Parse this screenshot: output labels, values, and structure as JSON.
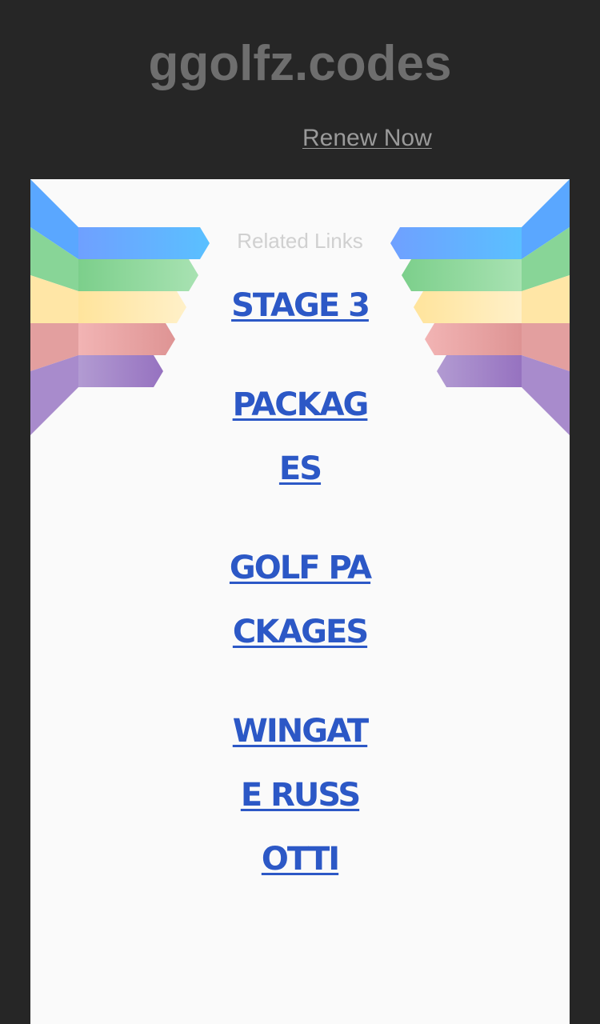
{
  "header": {
    "site_title": "ggolfz.codes",
    "renew_label": "Renew Now"
  },
  "panel": {
    "related_heading": "Related Links",
    "links": [
      "STAGE 3",
      "PACKAGES",
      "GOLF PACKAGES",
      "WINGATE RUSSOTTI"
    ]
  },
  "colors": {
    "background": "#262626",
    "panel": "#fafafa",
    "link": "#2c58c6",
    "ribbon_blue": "#5aa7ff",
    "ribbon_green": "#7fd08f",
    "ribbon_yellow": "#ffe29a",
    "ribbon_red": "#ec9c9c",
    "ribbon_purple": "#9d7dc2"
  }
}
